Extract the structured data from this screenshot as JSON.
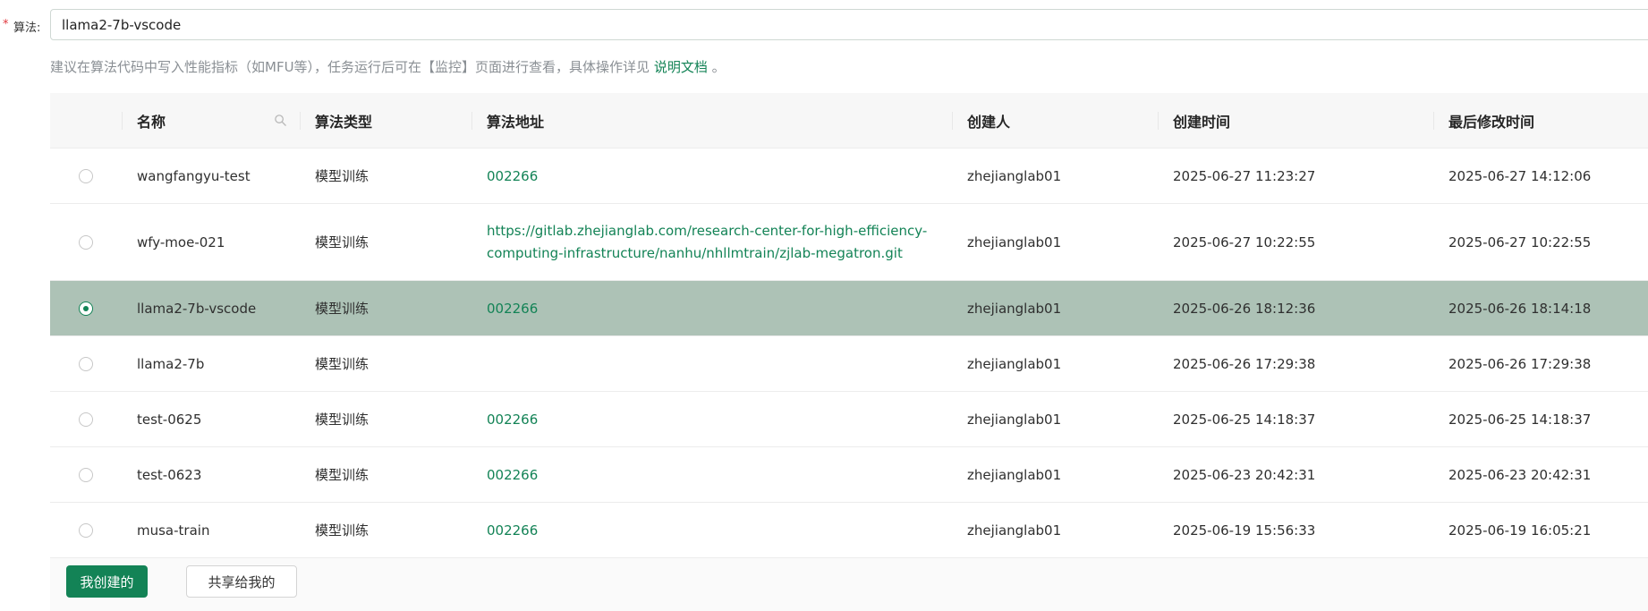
{
  "form": {
    "required_mark": "*",
    "label": "算法:",
    "value": "llama2-7b-vscode"
  },
  "hint": {
    "text": "建议在算法代码中写入性能指标（如MFU等），任务运行后可在【监控】页面进行查看，具体操作详见",
    "link_text": "说明文档",
    "suffix": "。"
  },
  "table": {
    "headers": {
      "name": "名称",
      "type": "算法类型",
      "address": "算法地址",
      "creator": "创建人",
      "created": "创建时间",
      "modified": "最后修改时间"
    },
    "rows": [
      {
        "name": "wangfangyu-test",
        "type": "模型训练",
        "address": "002266",
        "creator": "zhejianglab01",
        "created": "2025-06-27 11:23:27",
        "modified": "2025-06-27 14:12:06",
        "selected": false
      },
      {
        "name": "wfy-moe-021",
        "type": "模型训练",
        "address": "https://gitlab.zhejianglab.com/research-center-for-high-efficiency-computing-infrastructure/nanhu/nhllmtrain/zjlab-megatron.git",
        "address_line1": "https://gitlab.zhejianglab.com/research-center-for-high-efficiency-",
        "address_line2": "computing-infrastructure/nanhu/nhllmtrain/zjlab-megatron.git",
        "creator": "zhejianglab01",
        "created": "2025-06-27 10:22:55",
        "modified": "2025-06-27 10:22:55",
        "selected": false
      },
      {
        "name": "llama2-7b-vscode",
        "type": "模型训练",
        "address": "002266",
        "creator": "zhejianglab01",
        "created": "2025-06-26 18:12:36",
        "modified": "2025-06-26 18:14:18",
        "selected": true
      },
      {
        "name": "llama2-7b",
        "type": "模型训练",
        "address": "",
        "creator": "zhejianglab01",
        "created": "2025-06-26 17:29:38",
        "modified": "2025-06-26 17:29:38",
        "selected": false
      },
      {
        "name": "test-0625",
        "type": "模型训练",
        "address": "002266",
        "creator": "zhejianglab01",
        "created": "2025-06-25 14:18:37",
        "modified": "2025-06-25 14:18:37",
        "selected": false
      },
      {
        "name": "test-0623",
        "type": "模型训练",
        "address": "002266",
        "creator": "zhejianglab01",
        "created": "2025-06-23 20:42:31",
        "modified": "2025-06-23 20:42:31",
        "selected": false
      },
      {
        "name": "musa-train",
        "type": "模型训练",
        "address": "002266",
        "creator": "zhejianglab01",
        "created": "2025-06-19 15:56:33",
        "modified": "2025-06-19 16:05:21",
        "selected": false
      }
    ]
  },
  "footer": {
    "mine_label": "我创建的",
    "shared_label": "共享给我的"
  },
  "colors": {
    "accent": "#138356",
    "selected_row": "#adc2b6",
    "required": "#e0383e"
  },
  "icons": {
    "name_filter": "search-icon"
  }
}
